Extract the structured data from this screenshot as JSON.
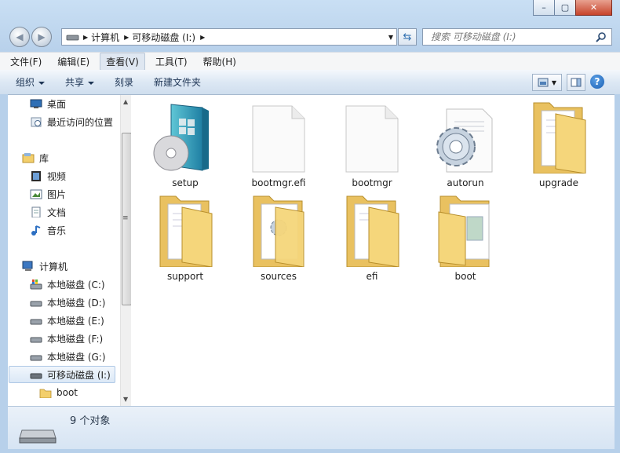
{
  "window": {
    "min_symbol": "–",
    "max_symbol": "▢",
    "close_symbol": "✕"
  },
  "address": {
    "path": [
      "计算机",
      "可移动磁盘 (I:)"
    ],
    "search_placeholder": "搜索 可移动磁盘 (I:)"
  },
  "menu": [
    "文件(F)",
    "编辑(E)",
    "查看(V)",
    "工具(T)",
    "帮助(H)"
  ],
  "toolbar": {
    "organize": "组织",
    "share": "共享",
    "burn": "刻录",
    "new_folder": "新建文件夹"
  },
  "sidebar": {
    "desktop": "桌面",
    "recent": "最近访问的位置",
    "library": "库",
    "video": "视频",
    "pictures": "图片",
    "documents": "文档",
    "music": "音乐",
    "computer": "计算机",
    "c": "本地磁盘 (C:)",
    "d": "本地磁盘 (D:)",
    "e": "本地磁盘 (E:)",
    "f": "本地磁盘 (F:)",
    "g": "本地磁盘 (G:)",
    "i": "可移动磁盘 (I:)",
    "boot": "boot"
  },
  "files": [
    "setup",
    "bootmgr.efi",
    "bootmgr",
    "autorun",
    "upgrade",
    "support",
    "sources",
    "efi",
    "boot"
  ],
  "details": {
    "count": "9 个对象"
  },
  "colors": {
    "selection": "#dbe8f6",
    "folder": "#f5d67b",
    "accent": "#1b5fb3"
  }
}
